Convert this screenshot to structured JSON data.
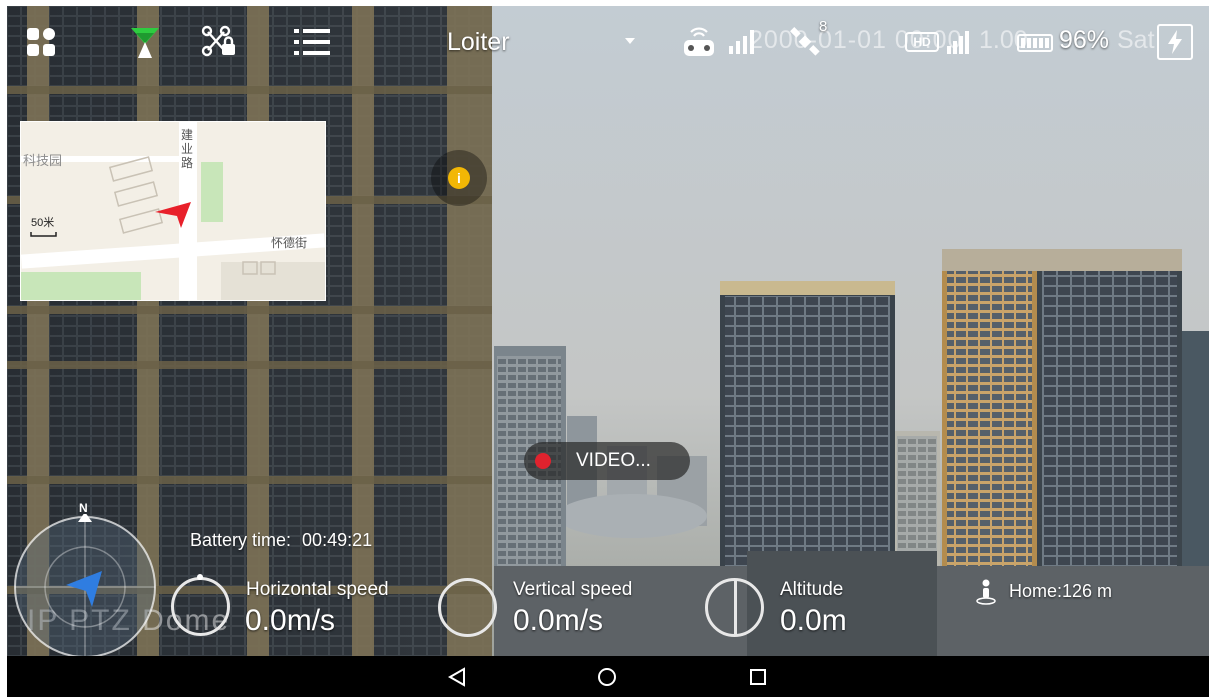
{
  "top_bar": {
    "flight_mode": "Loiter",
    "signal_pill": "1.00",
    "gps_satellites": "8",
    "hd_label": "HD",
    "battery_percent": "96%",
    "remote_time_text": "2000-01-01 00:00",
    "suffix_text": "Sat"
  },
  "minimap": {
    "labels": {
      "tech_park": "科技园",
      "road_vertical": "建业路",
      "road_horizontal": "怀德街",
      "scale": "50米"
    }
  },
  "video": {
    "status_label": "VIDEO..."
  },
  "compass": {
    "north_label": "N"
  },
  "telemetry": {
    "battery_time_label": "Battery time:",
    "battery_time_value": "00:49:21",
    "horizontal_speed_label": "Horizontal speed",
    "horizontal_speed_value": "0.0m/s",
    "vertical_speed_label": "Vertical speed",
    "vertical_speed_value": "0.0m/s",
    "altitude_label": "Altitude",
    "altitude_value": "0.0m",
    "home_distance": "Home:126 m"
  },
  "watermark": "IP PTZ Dome",
  "icons": [
    "apps-grid-icon",
    "signal-beacon-icon",
    "drone-lock-icon",
    "list-menu-icon",
    "dropdown-caret-icon",
    "remote-controller-icon",
    "signal-bars-icon",
    "satellite-icon",
    "hd-video-icon",
    "battery-icon",
    "charging-icon",
    "info-icon",
    "record-dot-icon",
    "compass-icon",
    "drone-heading-arrow-icon",
    "home-person-icon",
    "back-triangle-icon",
    "home-circle-icon",
    "recents-square-icon"
  ],
  "colors": {
    "accent_green": "#2ecc40",
    "record_red": "#e0232e",
    "info_yellow": "#f2b705",
    "drone_arrow_blue": "#2f7de1",
    "map_arrow_red": "#e8202a"
  }
}
